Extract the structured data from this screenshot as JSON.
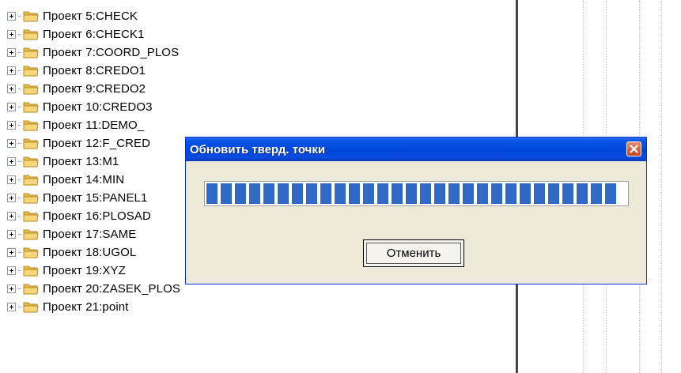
{
  "tree": {
    "items": [
      {
        "label": "Проект 5:CHECK"
      },
      {
        "label": "Проект 6:CHECK1"
      },
      {
        "label": "Проект 7:COORD_PLOS"
      },
      {
        "label": "Проект 8:CREDO1"
      },
      {
        "label": "Проект 9:CREDO2"
      },
      {
        "label": "Проект 10:CREDO3"
      },
      {
        "label": "Проект 11:DEMO_"
      },
      {
        "label": "Проект 12:F_CRED"
      },
      {
        "label": "Проект 13:M1"
      },
      {
        "label": "Проект 14:MIN"
      },
      {
        "label": "Проект 15:PANEL1"
      },
      {
        "label": "Проект 16:PLOSAD"
      },
      {
        "label": "Проект 17:SAME"
      },
      {
        "label": "Проект 18:UGOL"
      },
      {
        "label": "Проект 19:XYZ"
      },
      {
        "label": "Проект 20:ZASEK_PLOS"
      },
      {
        "label": "Проект 21:point"
      }
    ]
  },
  "dialog": {
    "title": "Обновить тверд. точки",
    "progress_percent": 100,
    "cancel_label": "Отменить"
  },
  "colors": {
    "titlebar": "#0a56e8",
    "progress_block": "#3169c6",
    "dialog_bg": "#ece9d8",
    "folder": "#f5d67a"
  },
  "icons": {
    "tree_expander": "plus-box-icon",
    "tree_folder": "folder-icon",
    "dialog_close": "close-icon"
  }
}
